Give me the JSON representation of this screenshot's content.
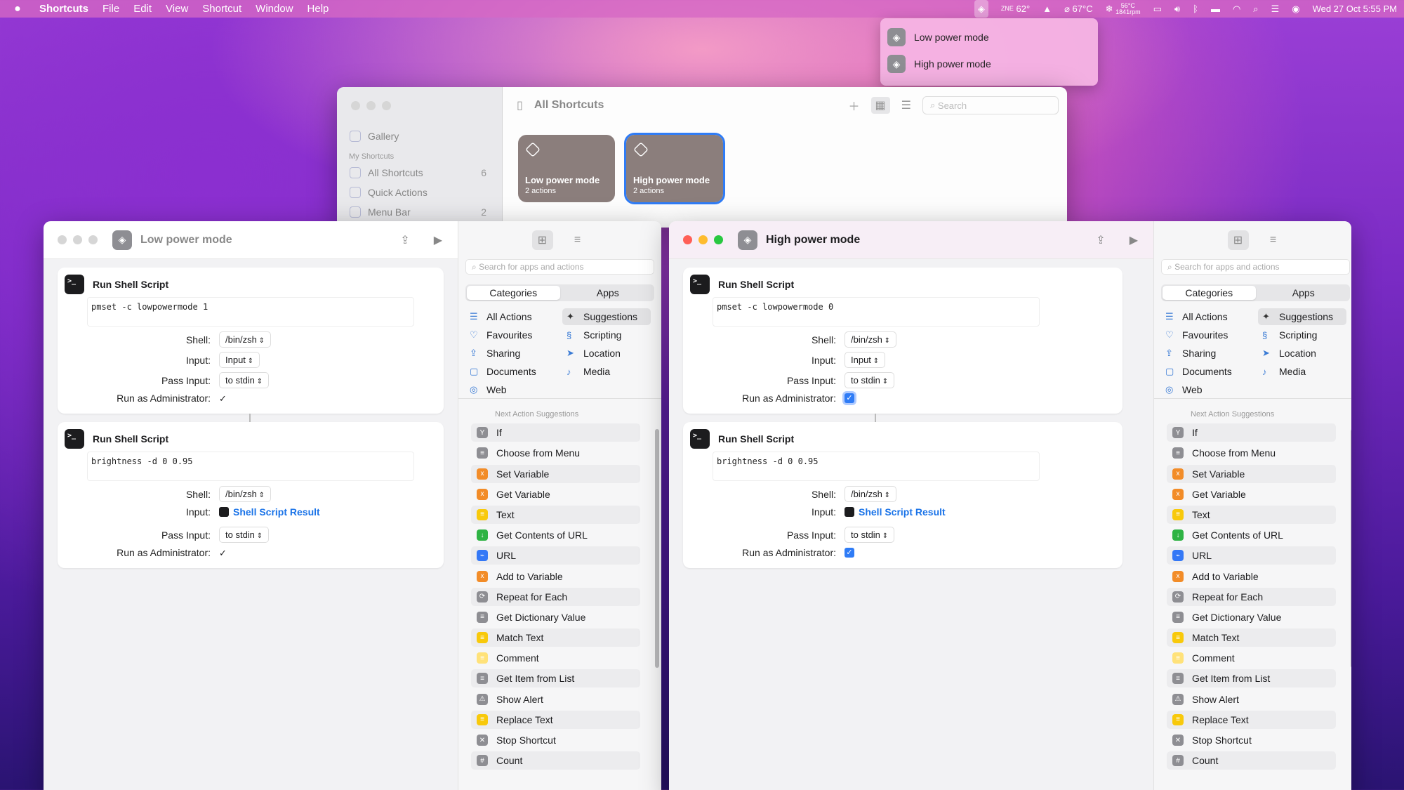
{
  "menubar": {
    "apple": "",
    "app": "Shortcuts",
    "menus": [
      "File",
      "Edit",
      "View",
      "Shortcut",
      "Window",
      "Help"
    ],
    "status": {
      "temp": "62°",
      "cpu": "67°C",
      "fan_top": "56°C",
      "fan_bottom": "1841rpm",
      "datetime": "Wed 27 Oct  5:55 PM",
      "weather_side": "ZNE"
    }
  },
  "dropdown": {
    "items": [
      "Low power mode",
      "High power mode"
    ]
  },
  "library": {
    "sidebar": {
      "gallery": "Gallery",
      "section": "My Shortcuts",
      "all": "All Shortcuts",
      "all_count": "6",
      "quick": "Quick Actions",
      "menubar": "Menu Bar",
      "menubar_count": "2"
    },
    "title": "All Shortcuts",
    "search_placeholder": "Search",
    "cards": [
      {
        "name": "Low power mode",
        "actions": "2 actions"
      },
      {
        "name": "High power mode",
        "actions": "2 actions"
      }
    ]
  },
  "editors": [
    {
      "title": "Low power mode",
      "actions": [
        {
          "title": "Run Shell Script",
          "script": "pmset -c lowpowermode 1",
          "shell": "/bin/zsh",
          "input": "Input",
          "pass": "to stdin",
          "admin": "✓"
        },
        {
          "title": "Run Shell Script",
          "script": "brightness -d 0 0.95",
          "shell": "/bin/zsh",
          "input": "Shell Script Result",
          "pass": "to stdin",
          "admin": "✓"
        }
      ]
    },
    {
      "title": "High power mode",
      "actions": [
        {
          "title": "Run Shell Script",
          "script": "pmset -c lowpowermode 0",
          "shell": "/bin/zsh",
          "input": "Input",
          "pass": "to stdin",
          "admin": "✓"
        },
        {
          "title": "Run Shell Script",
          "script": "brightness -d 0 0.95",
          "shell": "/bin/zsh",
          "input": "Shell Script Result",
          "pass": "to stdin",
          "admin": "✓"
        }
      ]
    }
  ],
  "labels": {
    "shell": "Shell:",
    "input": "Input:",
    "pass": "Pass Input:",
    "admin": "Run as Administrator:"
  },
  "panel": {
    "search_placeholder": "Search for apps and actions",
    "tab_categories": "Categories",
    "tab_apps": "Apps",
    "categories": [
      "All Actions",
      "Suggestions",
      "Favourites",
      "Scripting",
      "Sharing",
      "Location",
      "Documents",
      "Media",
      "Web"
    ],
    "next_title": "Next Action Suggestions",
    "actions": [
      "If",
      "Choose from Menu",
      "Set Variable",
      "Get Variable",
      "Text",
      "Get Contents of URL",
      "URL",
      "Add to Variable",
      "Repeat for Each",
      "Get Dictionary Value",
      "Match Text",
      "Comment",
      "Get Item from List",
      "Show Alert",
      "Replace Text",
      "Stop Shortcut",
      "Count"
    ]
  },
  "colors": {
    "accent": "#2f7cf6",
    "token": "#1a73e8",
    "orange": "#f28c28",
    "yellow": "#f8c90b",
    "green": "#2fb344",
    "blue": "#3478f6",
    "gray": "#8e8e93"
  }
}
